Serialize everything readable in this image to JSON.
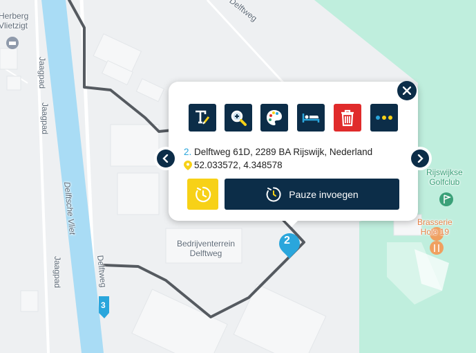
{
  "map": {
    "labels": {
      "herberg": "Herberg\nVlietzigt",
      "delftweg_top": "Delftweg",
      "jaagpad_1": "Jaagpad",
      "jaagpad_2": "Jaagpad",
      "jaagpad_3": "Jaagpad",
      "delftsche_vliet": "Delftsche Vliet",
      "delftweg_side": "Delftweg",
      "bedrijventerrein": "Bedrijventerrein\nDelftweg",
      "golfclub": "Rijswijkse\nGolfclub",
      "brasserie": "Brasserie\nHole 19"
    },
    "markers": {
      "stop_2": "2",
      "stop_3": "3"
    },
    "colors": {
      "water": "#a9dcf5",
      "green": "#bfeedd",
      "route": "#555a60",
      "marker": "#2aa6dc",
      "golf_pin": "#3aa078",
      "restaurant_pin": "#f0a060"
    }
  },
  "popup": {
    "tools": [
      "text-edit-icon",
      "zoom-icon",
      "palette-icon",
      "bed-icon",
      "trash-icon",
      "more-icon"
    ],
    "address_index": "2.",
    "address": "Delftweg 61D, 2289 BA Rijswijk, Nederland",
    "coordinates": "52.033572, 4.348578",
    "pause_label": "Pauze invoegen",
    "colors": {
      "primary": "#0c2d48",
      "delete": "#e02b2b",
      "timer": "#f7d117"
    }
  }
}
